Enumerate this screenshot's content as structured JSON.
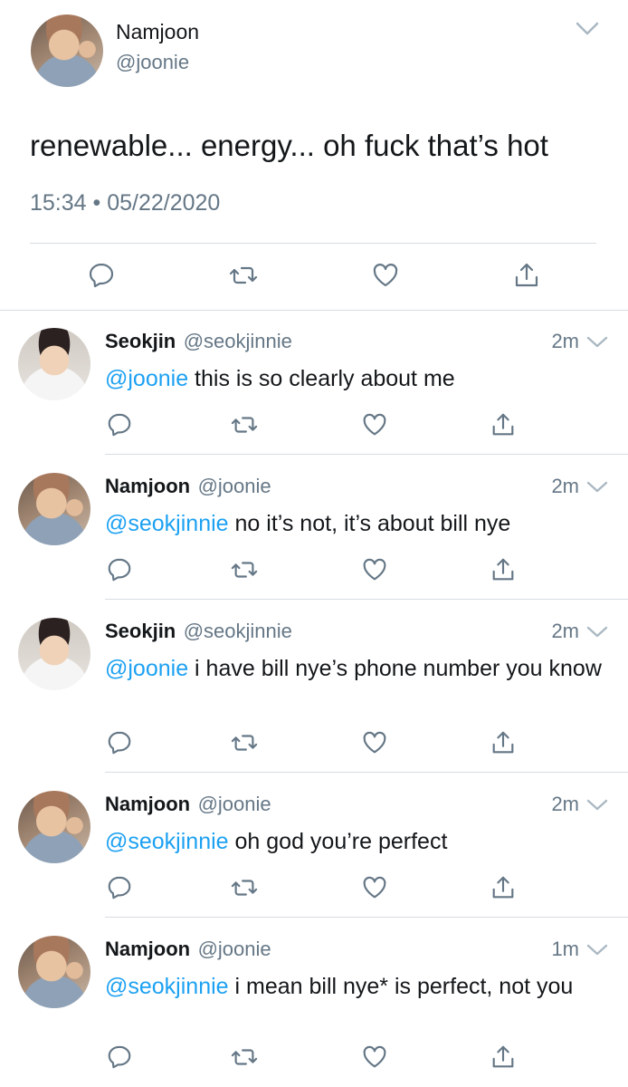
{
  "main_tweet": {
    "name": "Namjoon",
    "handle": "@joonie",
    "text": "renewable... energy... oh fuck that’s hot",
    "timestamp": "15:34 • 05/22/2020"
  },
  "replies": [
    {
      "name": "Seokjin",
      "handle": "@seokjinnie",
      "time": "2m",
      "mention": "@joonie",
      "text": " this is so clearly about me"
    },
    {
      "name": "Namjoon",
      "handle": "@joonie",
      "time": "2m",
      "mention": "@seokjinnie",
      "text": " no it’s not, it’s about bill nye"
    },
    {
      "name": "Seokjin",
      "handle": "@seokjinnie",
      "time": "2m",
      "mention": "@joonie",
      "text": " i have bill nye’s phone number you know"
    },
    {
      "name": "Namjoon",
      "handle": "@joonie",
      "time": "2m",
      "mention": "@seokjinnie",
      "text": " oh god you’re perfect"
    },
    {
      "name": "Namjoon",
      "handle": "@joonie",
      "time": "1m",
      "mention": "@seokjinnie",
      "text": " i mean bill nye* is perfect, not you"
    }
  ],
  "colors": {
    "link": "#1da1f2",
    "secondary": "#657786",
    "divider": "#d8dde2"
  },
  "icons": [
    "reply-icon",
    "retweet-icon",
    "like-icon",
    "share-icon",
    "chevron-down-icon"
  ]
}
